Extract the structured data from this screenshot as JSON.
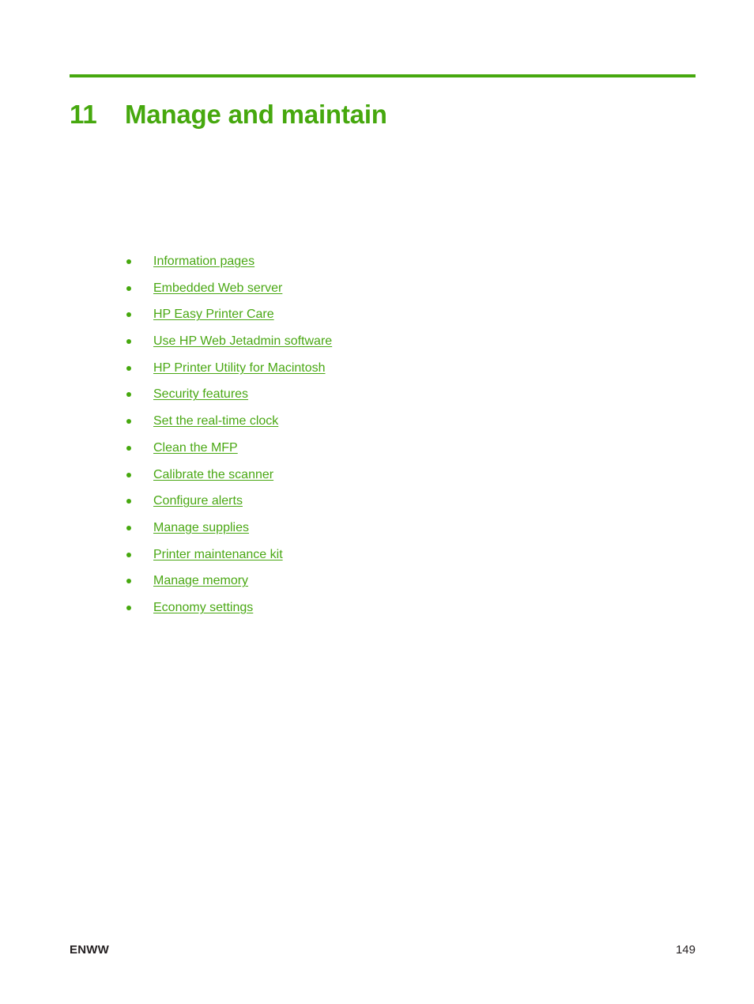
{
  "theme": {
    "accent_green": "#46a80e",
    "link_green": "#4aa814",
    "footer_text": "#231f20",
    "page_background": "#ffffff"
  },
  "chapter": {
    "number": "11",
    "title": "Manage and maintain"
  },
  "toc": {
    "bullet_icon": "bullet-dot-icon",
    "items": [
      {
        "label": "Information pages"
      },
      {
        "label": "Embedded Web server"
      },
      {
        "label": "HP Easy Printer Care"
      },
      {
        "label": "Use HP Web Jetadmin software"
      },
      {
        "label": "HP Printer Utility for Macintosh"
      },
      {
        "label": "Security features"
      },
      {
        "label": "Set the real-time clock"
      },
      {
        "label": "Clean the MFP"
      },
      {
        "label": "Calibrate the scanner"
      },
      {
        "label": "Configure alerts"
      },
      {
        "label": "Manage supplies"
      },
      {
        "label": "Printer maintenance kit"
      },
      {
        "label": "Manage memory"
      },
      {
        "label": "Economy settings"
      }
    ]
  },
  "footer": {
    "locale": "ENWW",
    "page_number": "149"
  }
}
